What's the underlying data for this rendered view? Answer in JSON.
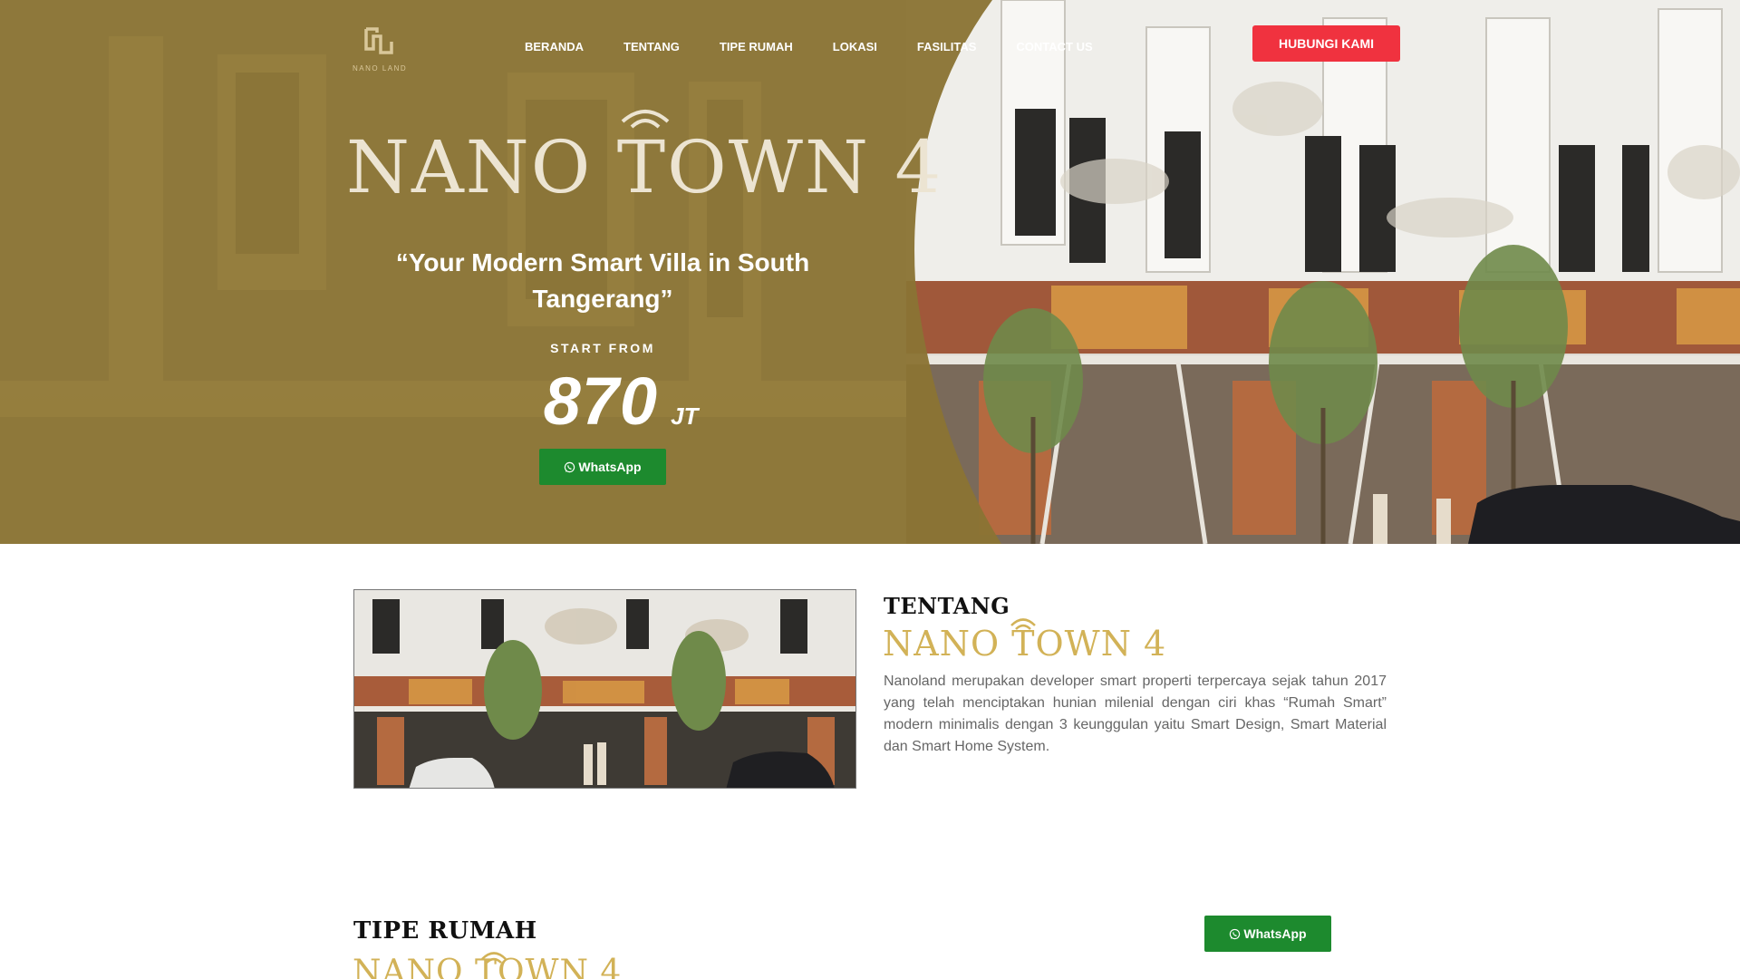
{
  "nav": {
    "logo_text": "NANO LAND",
    "items": [
      "BERANDA",
      "TENTANG",
      "TIPE RUMAH",
      "LOKASI",
      "FASILITAS",
      "CONTACT US"
    ],
    "cta_label": "HUBUNGI KAMI"
  },
  "hero": {
    "title": "NANO TOWN 4",
    "tagline": "“Your Modern Smart Villa in South Tangerang”",
    "start_from": "START FROM",
    "price_value": "870",
    "price_unit": "JT",
    "whatsapp_label": "WhatsApp"
  },
  "about": {
    "heading": "TENTANG",
    "brand": "NANO TOWN 4",
    "description": "Nanoland merupakan developer smart properti terpercaya sejak tahun 2017 yang telah menciptakan hunian milenial dengan ciri khas “Rumah Smart” modern minimalis dengan 3 keunggulan yaitu Smart Design, Smart Material dan Smart Home System."
  },
  "tipe": {
    "heading": "TIPE RUMAH",
    "brand": "NANO TOWN 4",
    "whatsapp_label": "WhatsApp"
  },
  "colors": {
    "gold_overlay": "#8a7434",
    "brand_gold": "#d2b257",
    "cta_red": "#f0323f",
    "whatsapp_green": "#1d8a2e"
  },
  "icons": {
    "logo": "nano-land-logo-icon",
    "wifi": "wifi-icon",
    "whatsapp": "whatsapp-icon"
  }
}
